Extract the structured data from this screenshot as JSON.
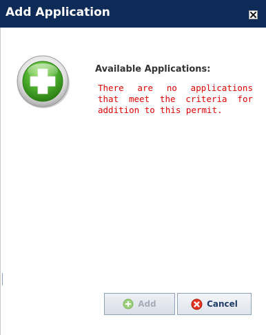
{
  "dialog": {
    "title": "Add Application",
    "close_icon": "close-icon"
  },
  "content": {
    "icon": "add-plus-icon",
    "heading": "Available Applications:",
    "message_lines": [
      "There are no applications",
      "that meet the criteria for",
      "addition to this permit."
    ]
  },
  "buttons": {
    "add_label": "Add",
    "add_icon": "add-circle-icon",
    "add_state": "disabled",
    "cancel_label": "Cancel",
    "cancel_icon": "cancel-x-icon"
  },
  "colors": {
    "titlebar": "#0e2a57",
    "message_text": "#e00000",
    "icon_green": "#4cae2c"
  }
}
